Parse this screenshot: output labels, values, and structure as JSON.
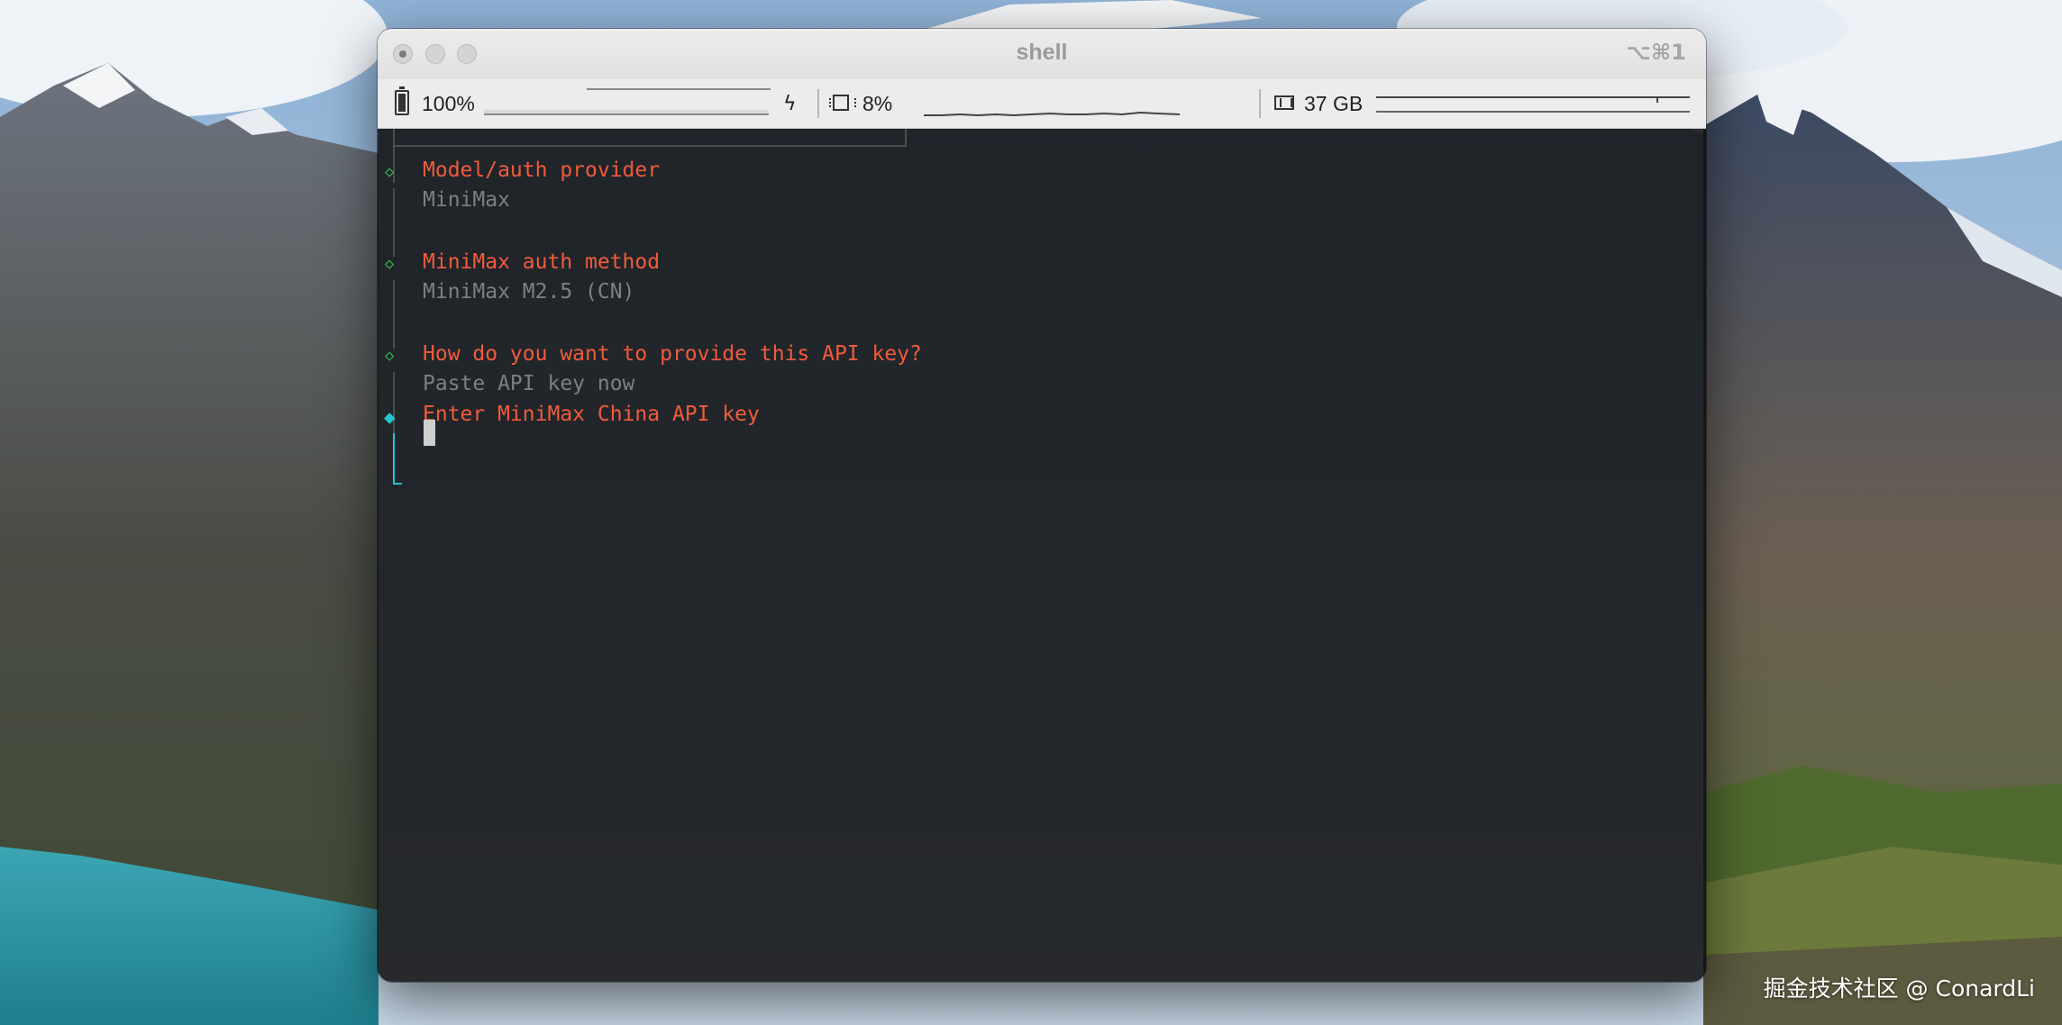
{
  "window": {
    "title": "shell",
    "shortcut": "⌥⌘1"
  },
  "status_bar": {
    "battery": {
      "label": "100%",
      "level": 1.0,
      "charging": true
    },
    "cpu": {
      "label": "8%",
      "level": 0.08
    },
    "memory": {
      "label": "37 GB"
    }
  },
  "terminal": {
    "prompts": [
      {
        "question": "Model/auth provider",
        "answer": "MiniMax"
      },
      {
        "question": "MiniMax auth method",
        "answer": "MiniMax M2.5 (CN)"
      },
      {
        "question": "How do you want to provide this API key?",
        "answer": "Paste API key now"
      }
    ],
    "active_prompt": {
      "question": "Enter MiniMax China API key",
      "input": ""
    }
  },
  "watermark": "掘金技术社区 @ ConardLi",
  "colors": {
    "question": "#f25a3c",
    "answer": "#7f7f7f",
    "done_marker": "#3fb54b",
    "active_marker": "#25c4cf"
  },
  "icons": [
    "battery-icon",
    "bolt-icon",
    "cpu-icon",
    "memory-icon"
  ]
}
